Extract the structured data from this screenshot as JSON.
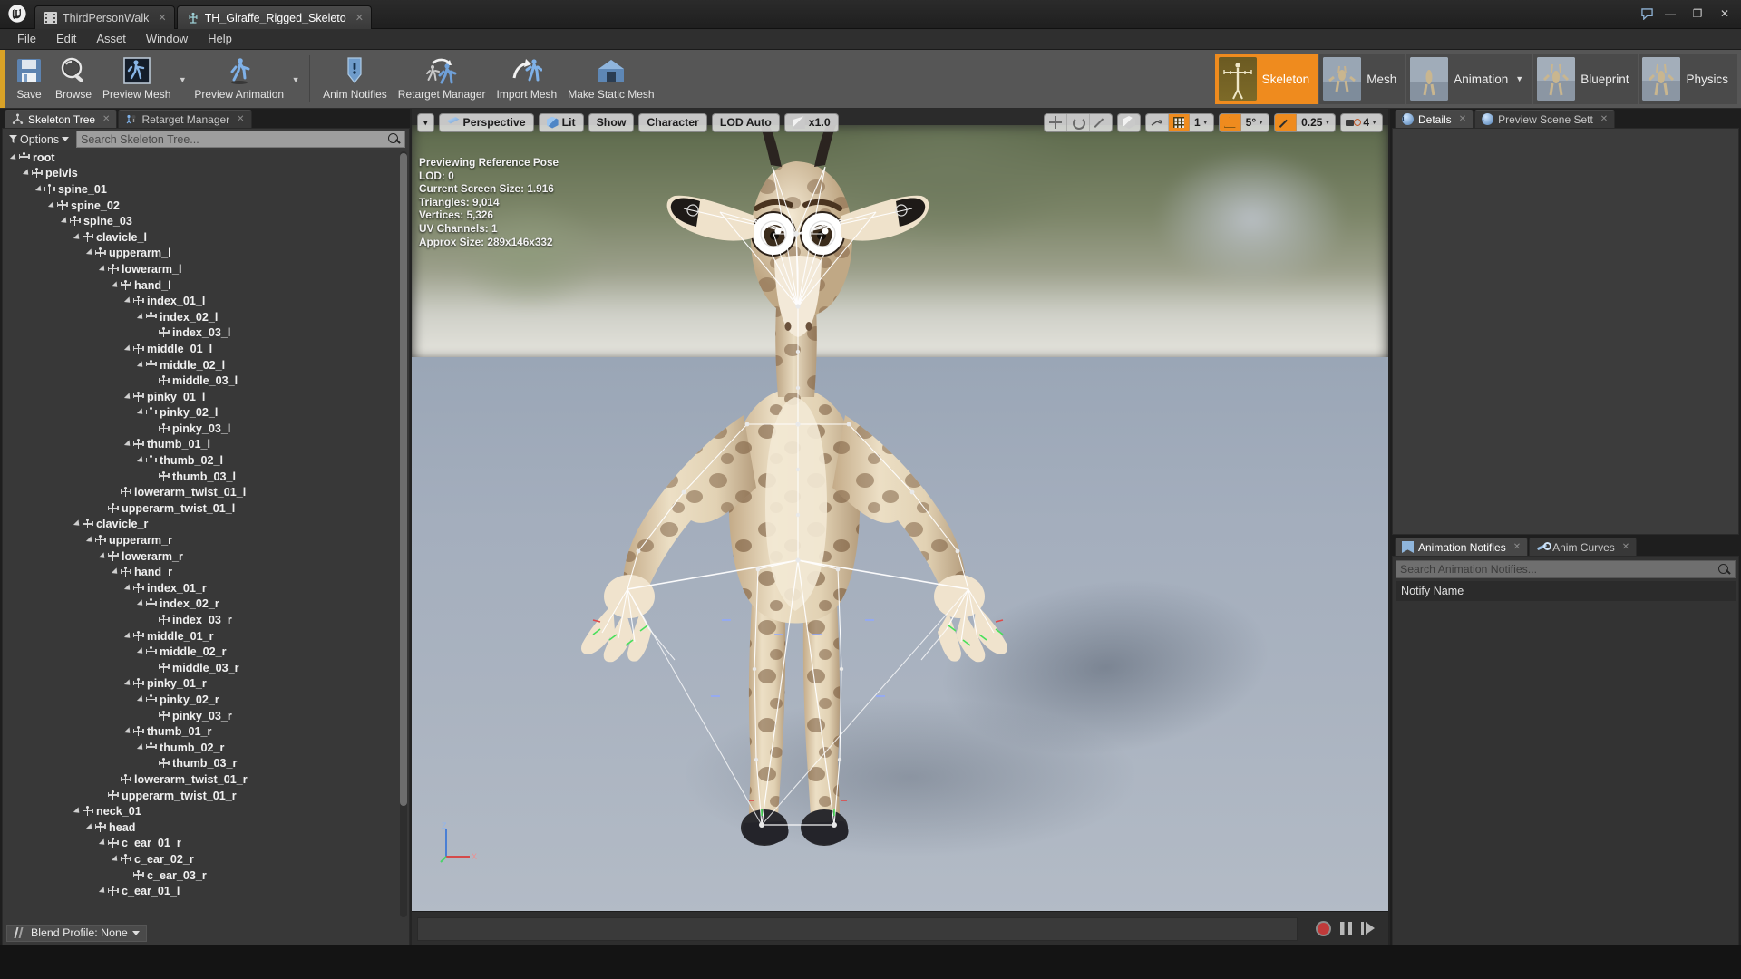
{
  "window": {
    "tabs": [
      {
        "label": "ThirdPersonWalk",
        "icon": "film-icon",
        "active": false
      },
      {
        "label": "TH_Giraffe_Rigged_Skeleto",
        "icon": "skeleton-icon",
        "active": true
      }
    ],
    "controls": {
      "minimize": "—",
      "maximize": "❐",
      "close": "✕"
    }
  },
  "menu": {
    "items": [
      "File",
      "Edit",
      "Asset",
      "Window",
      "Help"
    ]
  },
  "toolbar": {
    "groups": [
      {
        "buttons": [
          {
            "label": "Save",
            "icon": "save-icon",
            "dropdown": false
          },
          {
            "label": "Browse",
            "icon": "browse-icon",
            "dropdown": false
          },
          {
            "label": "Preview Mesh",
            "icon": "preview-mesh-icon",
            "dropdown": true
          },
          {
            "label": "Preview Animation",
            "icon": "preview-animation-icon",
            "dropdown": true
          }
        ]
      },
      {
        "buttons": [
          {
            "label": "Anim Notifies",
            "icon": "anim-notifies-icon",
            "dropdown": false
          },
          {
            "label": "Retarget Manager",
            "icon": "retarget-manager-icon",
            "dropdown": false
          },
          {
            "label": "Import Mesh",
            "icon": "import-mesh-icon",
            "dropdown": false
          },
          {
            "label": "Make Static Mesh",
            "icon": "make-static-mesh-icon",
            "dropdown": false
          }
        ]
      }
    ],
    "modes": [
      {
        "label": "Skeleton",
        "active": true,
        "dropdown": false
      },
      {
        "label": "Mesh",
        "active": false,
        "dropdown": false
      },
      {
        "label": "Animation",
        "active": false,
        "dropdown": true
      },
      {
        "label": "Blueprint",
        "active": false,
        "dropdown": false
      },
      {
        "label": "Physics",
        "active": false,
        "dropdown": false
      }
    ],
    "accent_color": "#d9a227",
    "active_mode_color": "#ef8b1e"
  },
  "left_panel": {
    "tabs": [
      {
        "label": "Skeleton Tree",
        "icon": "skeleton-tree-icon",
        "active": true
      },
      {
        "label": "Retarget Manager",
        "icon": "retarget-manager-icon",
        "active": false
      }
    ],
    "options_label": "Options",
    "search_placeholder": "Search Skeleton Tree...",
    "blend_profile_label": "Blend Profile: None",
    "tree": [
      {
        "name": "root",
        "depth": 0,
        "expandable": true
      },
      {
        "name": "pelvis",
        "depth": 1,
        "expandable": true
      },
      {
        "name": "spine_01",
        "depth": 2,
        "expandable": true
      },
      {
        "name": "spine_02",
        "depth": 3,
        "expandable": true
      },
      {
        "name": "spine_03",
        "depth": 4,
        "expandable": true
      },
      {
        "name": "clavicle_l",
        "depth": 5,
        "expandable": true
      },
      {
        "name": "upperarm_l",
        "depth": 6,
        "expandable": true
      },
      {
        "name": "lowerarm_l",
        "depth": 7,
        "expandable": true
      },
      {
        "name": "hand_l",
        "depth": 8,
        "expandable": true
      },
      {
        "name": "index_01_l",
        "depth": 9,
        "expandable": true
      },
      {
        "name": "index_02_l",
        "depth": 10,
        "expandable": true
      },
      {
        "name": "index_03_l",
        "depth": 11,
        "expandable": false
      },
      {
        "name": "middle_01_l",
        "depth": 9,
        "expandable": true
      },
      {
        "name": "middle_02_l",
        "depth": 10,
        "expandable": true
      },
      {
        "name": "middle_03_l",
        "depth": 11,
        "expandable": false
      },
      {
        "name": "pinky_01_l",
        "depth": 9,
        "expandable": true
      },
      {
        "name": "pinky_02_l",
        "depth": 10,
        "expandable": true
      },
      {
        "name": "pinky_03_l",
        "depth": 11,
        "expandable": false
      },
      {
        "name": "thumb_01_l",
        "depth": 9,
        "expandable": true
      },
      {
        "name": "thumb_02_l",
        "depth": 10,
        "expandable": true
      },
      {
        "name": "thumb_03_l",
        "depth": 11,
        "expandable": false
      },
      {
        "name": "lowerarm_twist_01_l",
        "depth": 8,
        "expandable": false
      },
      {
        "name": "upperarm_twist_01_l",
        "depth": 7,
        "expandable": false
      },
      {
        "name": "clavicle_r",
        "depth": 5,
        "expandable": true
      },
      {
        "name": "upperarm_r",
        "depth": 6,
        "expandable": true
      },
      {
        "name": "lowerarm_r",
        "depth": 7,
        "expandable": true
      },
      {
        "name": "hand_r",
        "depth": 8,
        "expandable": true
      },
      {
        "name": "index_01_r",
        "depth": 9,
        "expandable": true
      },
      {
        "name": "index_02_r",
        "depth": 10,
        "expandable": true
      },
      {
        "name": "index_03_r",
        "depth": 11,
        "expandable": false
      },
      {
        "name": "middle_01_r",
        "depth": 9,
        "expandable": true
      },
      {
        "name": "middle_02_r",
        "depth": 10,
        "expandable": true
      },
      {
        "name": "middle_03_r",
        "depth": 11,
        "expandable": false
      },
      {
        "name": "pinky_01_r",
        "depth": 9,
        "expandable": true
      },
      {
        "name": "pinky_02_r",
        "depth": 10,
        "expandable": true
      },
      {
        "name": "pinky_03_r",
        "depth": 11,
        "expandable": false
      },
      {
        "name": "thumb_01_r",
        "depth": 9,
        "expandable": true
      },
      {
        "name": "thumb_02_r",
        "depth": 10,
        "expandable": true
      },
      {
        "name": "thumb_03_r",
        "depth": 11,
        "expandable": false
      },
      {
        "name": "lowerarm_twist_01_r",
        "depth": 8,
        "expandable": false
      },
      {
        "name": "upperarm_twist_01_r",
        "depth": 7,
        "expandable": false
      },
      {
        "name": "neck_01",
        "depth": 5,
        "expandable": true
      },
      {
        "name": "head",
        "depth": 6,
        "expandable": true
      },
      {
        "name": "c_ear_01_r",
        "depth": 7,
        "expandable": true
      },
      {
        "name": "c_ear_02_r",
        "depth": 8,
        "expandable": true
      },
      {
        "name": "c_ear_03_r",
        "depth": 9,
        "expandable": false
      },
      {
        "name": "c_ear_01_l",
        "depth": 7,
        "expandable": true
      }
    ]
  },
  "viewport": {
    "toolbar": {
      "view_menu_caret": "▾",
      "perspective": "Perspective",
      "lit": "Lit",
      "show": "Show",
      "character": "Character",
      "lod": "LOD Auto",
      "playrate": "x1.0",
      "grid_snap_value": "1",
      "rotation_snap_value": "5°",
      "scale_snap_value": "0.25",
      "camera_speed_value": "4"
    },
    "stats": [
      "Previewing Reference Pose",
      "LOD: 0",
      "Current Screen Size: 1.916",
      "Triangles: 9,014",
      "Vertices: 5,326",
      "UV Channels: 1",
      "Approx Size: 289x146x332"
    ],
    "axis_labels": {
      "z": "Z",
      "x": "X",
      "y": "Y"
    },
    "transport": {
      "record": "record-button",
      "pause": "pause-button",
      "step": "step-forward-button"
    }
  },
  "right_panel": {
    "details_tabs": [
      {
        "label": "Details",
        "icon": "details-icon",
        "active": true
      },
      {
        "label": "Preview Scene Sett",
        "icon": "preview-scene-icon",
        "active": false
      }
    ],
    "notify_tabs": [
      {
        "label": "Animation Notifies",
        "icon": "notify-icon",
        "active": true
      },
      {
        "label": "Anim Curves",
        "icon": "curves-icon",
        "active": false
      }
    ],
    "notify_search_placeholder": "Search Animation Notifies...",
    "notify_column_header": "Notify Name"
  }
}
